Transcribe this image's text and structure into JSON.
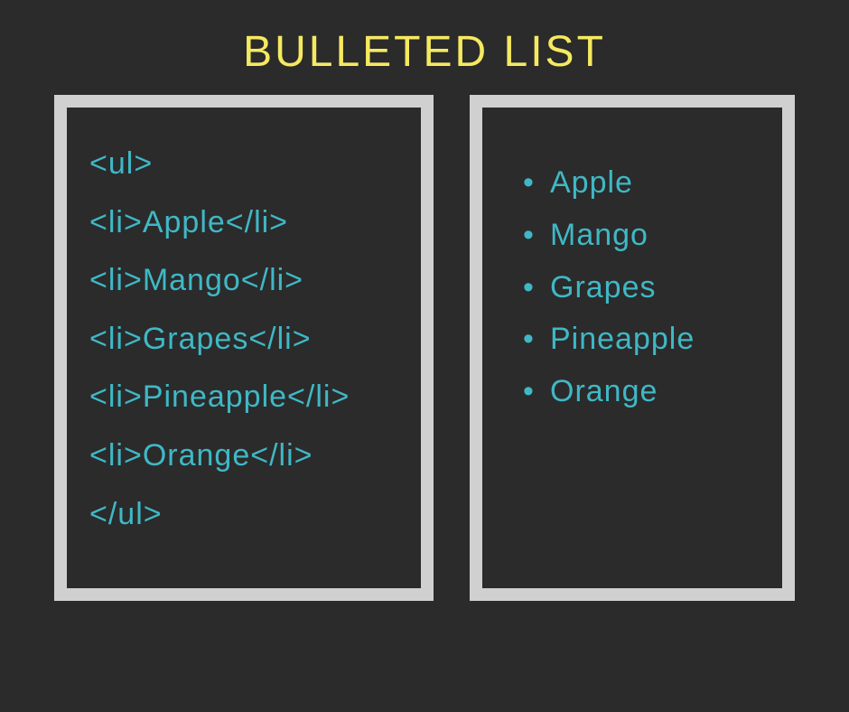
{
  "title": "BULLETED LIST",
  "code": {
    "lines": [
      "<ul>",
      "<li>Apple</li>",
      "<li>Mango</li>",
      "<li>Grapes</li>",
      "<li>Pineapple</li>",
      "<li>Orange</li>",
      "</ul>"
    ]
  },
  "output": {
    "items": [
      "Apple",
      "Mango",
      "Grapes",
      "Pineapple",
      "Orange"
    ]
  }
}
